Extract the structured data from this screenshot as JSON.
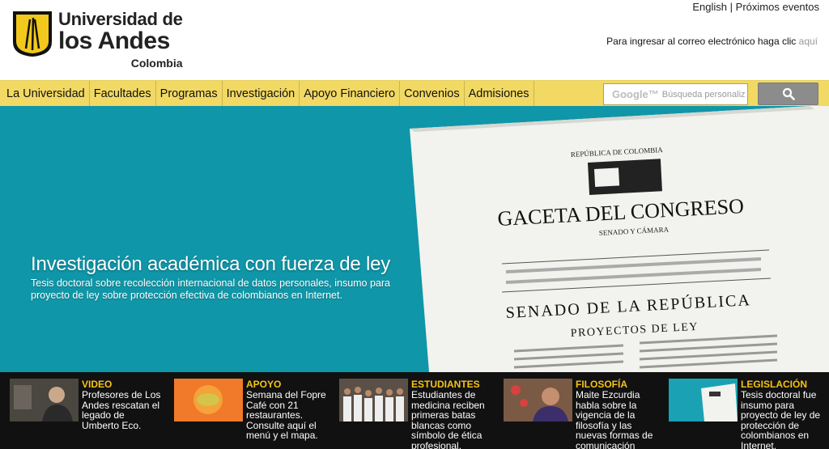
{
  "header": {
    "logo": {
      "line1": "Universidad de",
      "line2": "los Andes",
      "line3": "Colombia"
    },
    "top_links": {
      "english": "English",
      "separator": "|",
      "events": "Próximos eventos"
    },
    "mail": {
      "text": "Para ingresar al correo electrónico haga clic",
      "link": "aquí"
    }
  },
  "nav": {
    "items": [
      "La Universidad",
      "Facultades",
      "Programas",
      "Investigación",
      "Apoyo Financiero",
      "Convenios",
      "Admisiones"
    ],
    "search": {
      "brand": "Google™",
      "placeholder": "Búsqueda personaliz"
    }
  },
  "hero": {
    "title": "Investigación académica con fuerza de ley",
    "subtitle": "Tesis doctoral sobre recolección internacional de datos personales, insumo para proyecto de ley sobre protección efectiva de colombianos en Internet.",
    "document": {
      "republica": "REPÚBLICA DE COLOMBIA",
      "gaceta": "GACETA DEL CONGRESO",
      "senado_camara": "SENADO Y CÁMARA",
      "senado": "SENADO DE LA REPÚBLICA",
      "proyectos": "PROYECTOS DE LEY"
    }
  },
  "news": [
    {
      "category": "VIDEO",
      "text": "Profesores de Los Andes rescatan el legado de Umberto Eco."
    },
    {
      "category": "APOYO",
      "text": "Semana del Fopre Café con 21 restaurantes. Consulte aquí el menú y el mapa."
    },
    {
      "category": "ESTUDIANTES",
      "text": "Estudiantes de medicina reciben primeras batas blancas como símbolo de ética profesional."
    },
    {
      "category": "FILOSOFÍA",
      "text": "Maite Ezcurdia habla sobre la vigencia de la filosofía y las nuevas formas de comunicación"
    },
    {
      "category": "LEGISLACIÓN",
      "text": "Tesis doctoral fue insumo para proyecto de ley de protección de colombianos en Internet."
    }
  ],
  "colors": {
    "nav_bg": "#f2d964",
    "hero_bg": "#0f96a8",
    "strip_bg": "#111111",
    "accent": "#f6c315"
  }
}
